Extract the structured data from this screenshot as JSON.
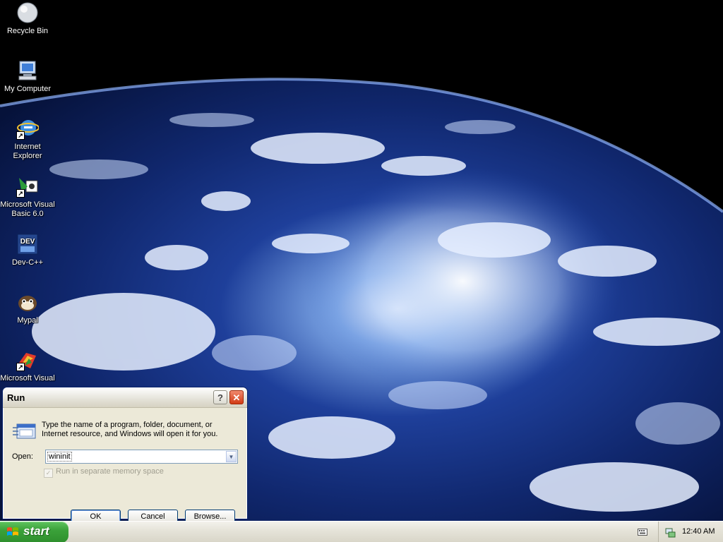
{
  "desktop": {
    "icons": [
      {
        "label": "Recycle Bin",
        "icon": "recycle-bin-icon"
      },
      {
        "label": "My Computer",
        "icon": "my-computer-icon"
      },
      {
        "label": "Internet Explorer",
        "icon": "internet-explorer-icon"
      },
      {
        "label": "Microsoft Visual Basic 6.0",
        "icon": "visual-basic-icon"
      },
      {
        "label": "Dev-C++",
        "icon": "dev-cpp-icon"
      },
      {
        "label": "Mypal",
        "icon": "mypal-icon"
      },
      {
        "label": "Microsoft Visual",
        "icon": "visual-studio-icon"
      }
    ]
  },
  "dialog": {
    "title": "Run",
    "help_glyph": "?",
    "close_glyph": "✕",
    "description": "Type the name of a program, folder, document, or Internet resource, and Windows will open it for you.",
    "open_label": "Open:",
    "open_value": "wininit",
    "checkbox_label": "Run in separate memory space",
    "checkbox_checked": true,
    "ok_label": "OK",
    "cancel_label": "Cancel",
    "browse_label": "Browse..."
  },
  "taskbar": {
    "start_label": "start",
    "clock": "12:40 AM"
  },
  "colors": {
    "start_green": "#3ba23a",
    "close_red": "#d23b14",
    "dialog_bg": "#ece9d8"
  }
}
